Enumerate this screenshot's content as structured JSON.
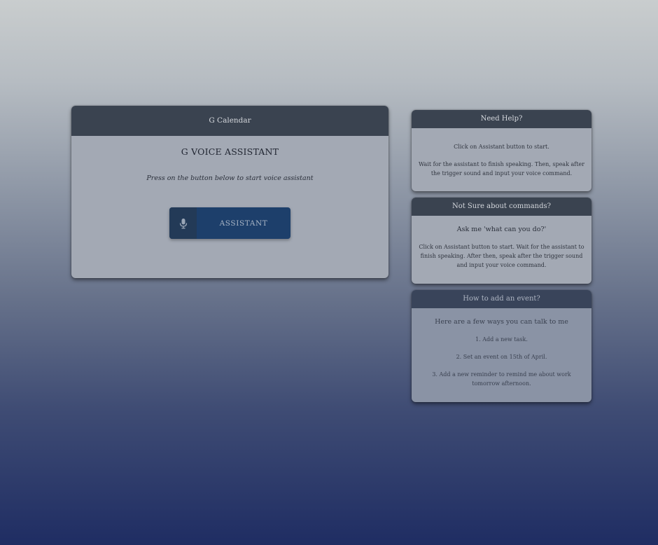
{
  "main": {
    "header": "G Calendar",
    "title": "G VOICE ASSISTANT",
    "subtitle": "Press on the button below to start voice assistant",
    "button_label": "ASSISTANT",
    "button_icon": "microphone-icon"
  },
  "help_cards": [
    {
      "header": "Need Help?",
      "lines": [
        "Click on Assistant button to start.",
        "Wait for the assistant to finish speaking. Then, speak after the trigger sound and input your voice command."
      ]
    },
    {
      "header": "Not Sure about commands?",
      "lead": "Ask me 'what can you do?'",
      "lines": [
        "Click on Assistant button to start. Wait for the assistant to finish speaking. After then, speak after the trigger sound and input your voice command."
      ]
    },
    {
      "header": "How to add an event?",
      "lead": "Here are a few ways you can talk to me",
      "lines": [
        "1. Add a new task.",
        "2. Set an event on 15th of April.",
        "3. Add a new reminder to remind me about work tomorrow afternoon."
      ]
    }
  ],
  "colors": {
    "header_bg": "#3a4350",
    "button_bg": "#1d3f6b",
    "card_bg": "#a3a9b4"
  }
}
